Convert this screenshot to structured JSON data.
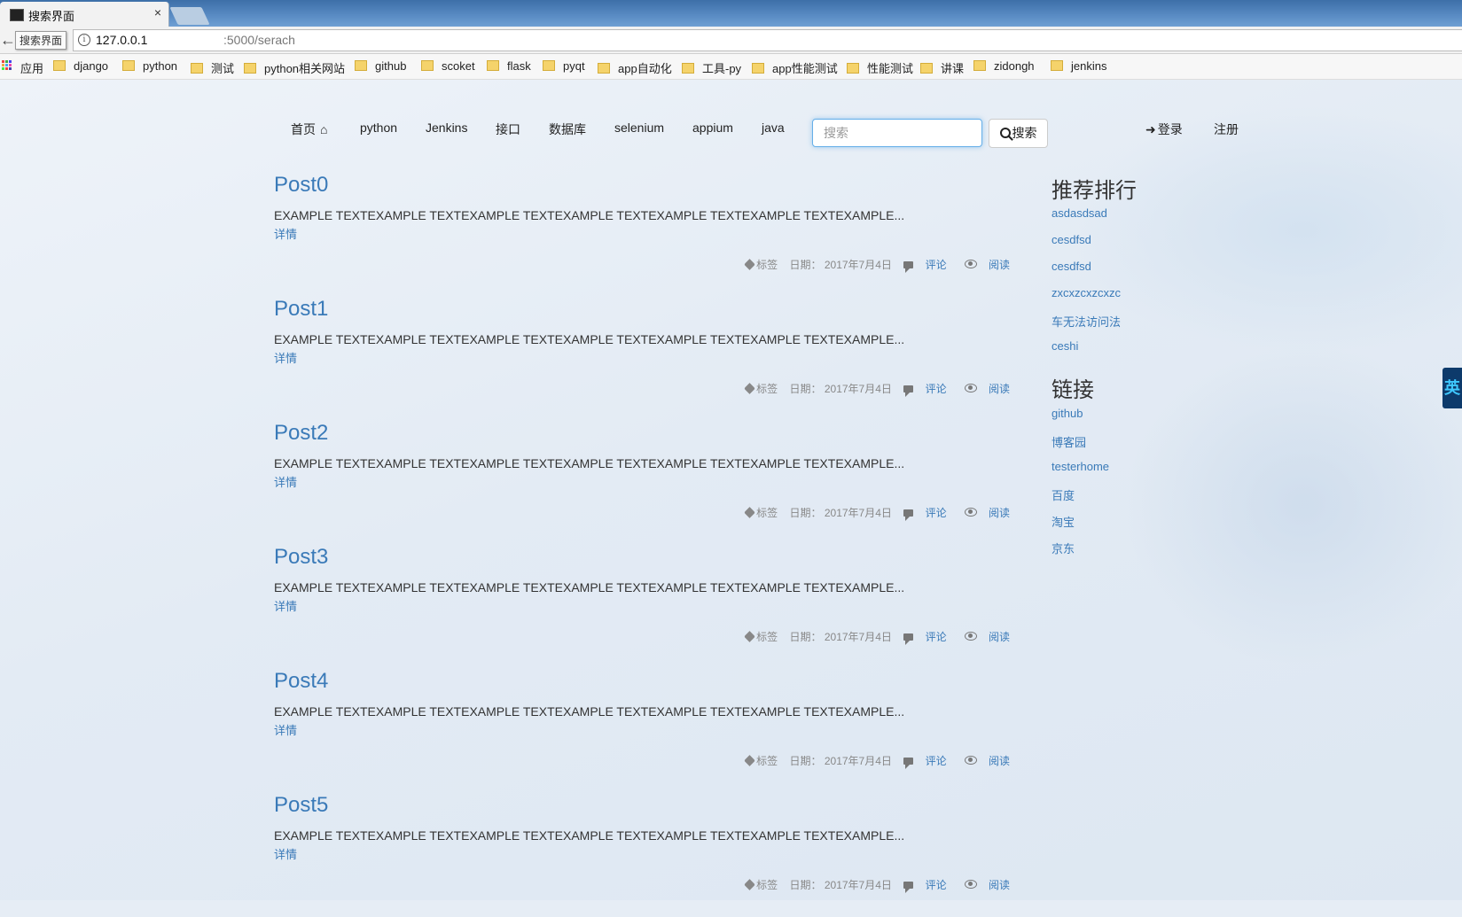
{
  "browser": {
    "tab_title": "搜索界面",
    "tab_close": "×",
    "back": "←",
    "tooltip": "搜索界面",
    "url_host": "127.0.0.1",
    "url_path": ":5000/serach",
    "info_icon": "i"
  },
  "bookmarks": [
    "应用",
    "django",
    "python",
    "测试",
    "python相关网站",
    "github",
    "scoket",
    "flask",
    "pyqt",
    "app自动化",
    "工具-py",
    "app性能测试",
    "性能测试",
    "讲课",
    "zidongh",
    "jenkins"
  ],
  "nav": {
    "items": [
      "首页",
      "python",
      "Jenkins",
      "接口",
      "数据库",
      "selenium",
      "appium",
      "java"
    ],
    "home_glyph": "⌂",
    "search_placeholder": "搜索",
    "search_button": "搜索",
    "login": "登录",
    "login_glyph": "➜",
    "register": "注册"
  },
  "posts": [
    {
      "title": "Post0",
      "excerpt": "EXAMPLE TEXTEXAMPLE TEXTEXAMPLE TEXTEXAMPLE TEXTEXAMPLE TEXTEXAMPLE TEXTEXAMPLE...",
      "more": "详情",
      "tag": "标签",
      "date": "日期： 2017年7月4日",
      "comment": "评论",
      "read": "阅读"
    },
    {
      "title": "Post1",
      "excerpt": "EXAMPLE TEXTEXAMPLE TEXTEXAMPLE TEXTEXAMPLE TEXTEXAMPLE TEXTEXAMPLE TEXTEXAMPLE...",
      "more": "详情",
      "tag": "标签",
      "date": "日期： 2017年7月4日",
      "comment": "评论",
      "read": "阅读"
    },
    {
      "title": "Post2",
      "excerpt": "EXAMPLE TEXTEXAMPLE TEXTEXAMPLE TEXTEXAMPLE TEXTEXAMPLE TEXTEXAMPLE TEXTEXAMPLE...",
      "more": "详情",
      "tag": "标签",
      "date": "日期： 2017年7月4日",
      "comment": "评论",
      "read": "阅读"
    },
    {
      "title": "Post3",
      "excerpt": "EXAMPLE TEXTEXAMPLE TEXTEXAMPLE TEXTEXAMPLE TEXTEXAMPLE TEXTEXAMPLE TEXTEXAMPLE...",
      "more": "详情",
      "tag": "标签",
      "date": "日期： 2017年7月4日",
      "comment": "评论",
      "read": "阅读"
    },
    {
      "title": "Post4",
      "excerpt": "EXAMPLE TEXTEXAMPLE TEXTEXAMPLE TEXTEXAMPLE TEXTEXAMPLE TEXTEXAMPLE TEXTEXAMPLE...",
      "more": "详情",
      "tag": "标签",
      "date": "日期： 2017年7月4日",
      "comment": "评论",
      "read": "阅读"
    },
    {
      "title": "Post5",
      "excerpt": "EXAMPLE TEXTEXAMPLE TEXTEXAMPLE TEXTEXAMPLE TEXTEXAMPLE TEXTEXAMPLE TEXTEXAMPLE...",
      "more": "详情",
      "tag": "标签",
      "date": "日期： 2017年7月4日",
      "comment": "评论",
      "read": "阅读"
    }
  ],
  "sidebar": {
    "ranking_title": "推荐排行",
    "ranking": [
      "asdasdsad",
      "cesdfsd",
      "cesdfsd",
      "zxcxzcxzcxzc",
      "车无法访问法",
      "ceshi"
    ],
    "links_title": "链接",
    "links": [
      "github",
      "博客园",
      "testerhome",
      "百度",
      "淘宝",
      "京东"
    ]
  },
  "ime": "英",
  "colors": {
    "link": "#3a7ab8",
    "focus": "#66afe9",
    "folder": "#f5d36b"
  }
}
